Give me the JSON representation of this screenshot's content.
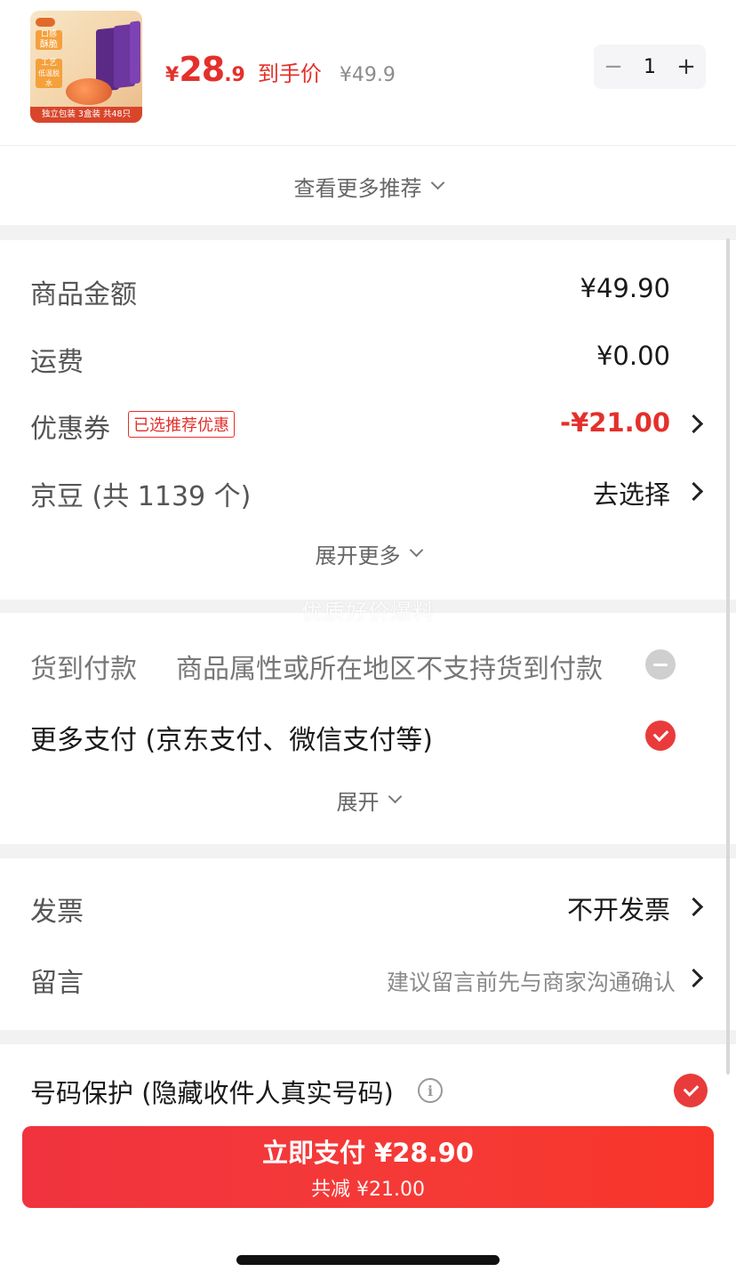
{
  "product": {
    "thumb_tag_1_top": "口感",
    "thumb_tag_1_bottom": "酥脆",
    "thumb_tag_2_top": "工艺",
    "thumb_tag_2_bottom": "低温脱水",
    "thumb_bar": "独立包装  3盒装  共48只",
    "price_currency": "¥",
    "price_integer": "28",
    "price_decimal": ".9",
    "price_label": "到手价",
    "original_price": "¥49.9",
    "quantity": "1",
    "minus_symbol": "−",
    "plus_symbol": "+"
  },
  "more_recommendations": "查看更多推荐",
  "summary": {
    "goods_amount_label": "商品金额",
    "goods_amount_value": "¥49.90",
    "shipping_label": "运费",
    "shipping_value": "¥0.00",
    "coupon_label": "优惠券",
    "coupon_badge": "已选推荐优惠",
    "coupon_value": "-¥21.00",
    "jingdou_label": "京豆 (共 1139 个)",
    "jingdou_value": "去选择",
    "expand_more": "展开更多"
  },
  "watermark": "优质好价爆料",
  "payment": {
    "cod_label": "货到付款",
    "cod_note": "商品属性或所在地区不支持货到付款",
    "more_pay_label": "更多支付 (京东支付、微信支付等)",
    "expand": "展开"
  },
  "invoice": {
    "invoice_label": "发票",
    "invoice_value": "不开发票",
    "message_label": "留言",
    "message_placeholder": "建议留言前先与商家沟通确认"
  },
  "privacy": {
    "label": "号码保护 (隐藏收件人真实号码)",
    "info_symbol": "i"
  },
  "pay_button": {
    "main": "立即支付 ¥28.90",
    "sub": "共减 ¥21.00"
  },
  "colors": {
    "accent_red": "#e4302b",
    "pay_button": "#f53a36",
    "section_gap": "#f2f2f2"
  }
}
